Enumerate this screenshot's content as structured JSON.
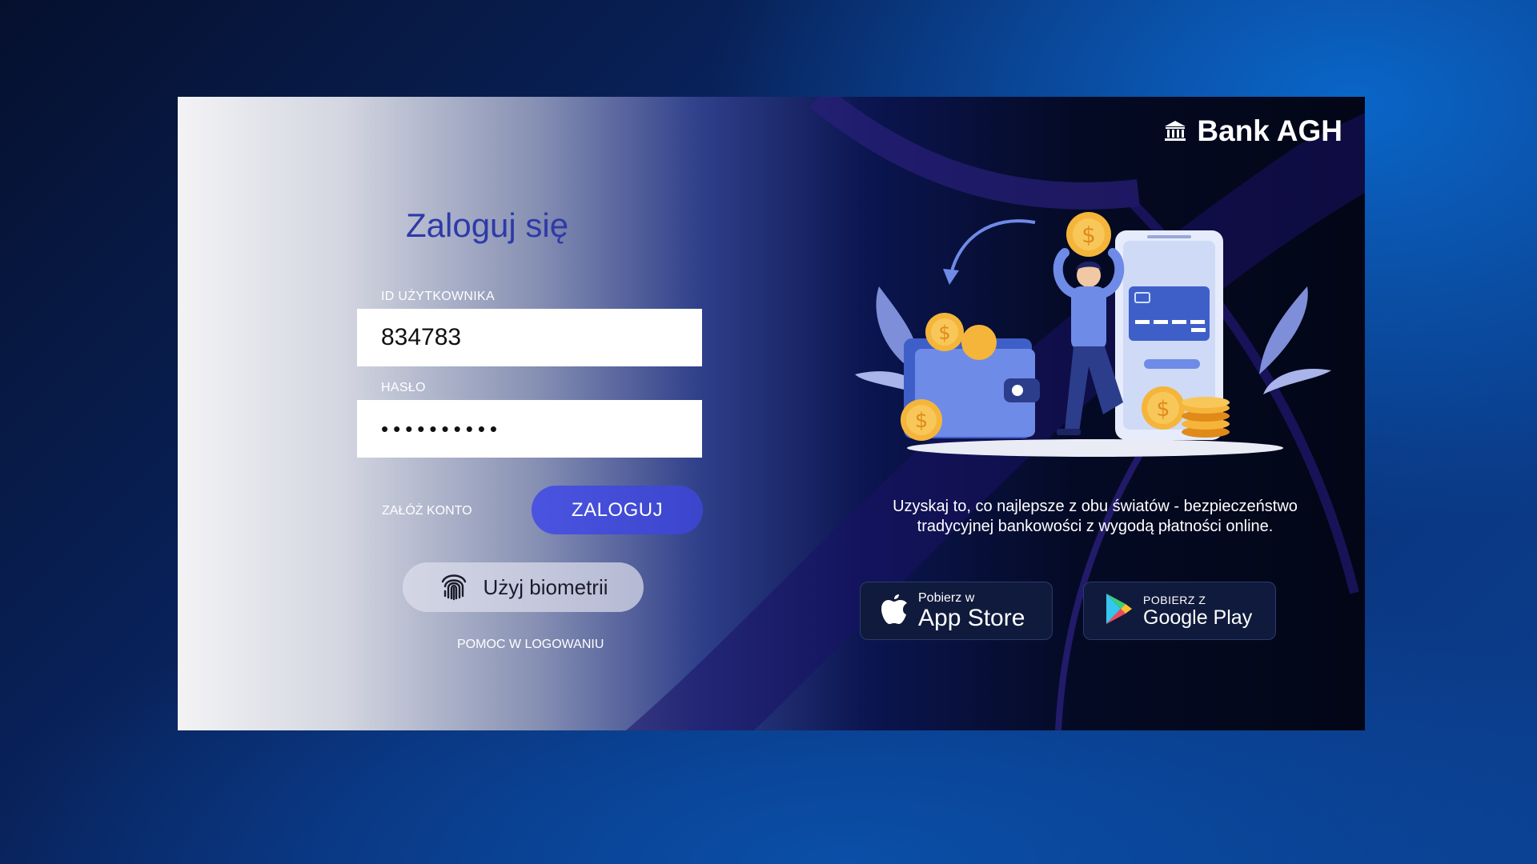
{
  "brand": {
    "name": "Bank AGH",
    "icon": "bank-building-icon"
  },
  "login": {
    "title": "Zaloguj się",
    "user_id": {
      "label": "ID UŻYTKOWNIKA",
      "value": "834783"
    },
    "password": {
      "label": "HASŁO",
      "masked_value": "••••••••••"
    },
    "register_link": "ZAŁÓŻ KONTO",
    "submit_label": "ZALOGUJ",
    "biometrics_label": "Użyj biometrii",
    "biometrics_icon": "fingerprint-icon",
    "help_link": "POMOC W LOGOWANIU"
  },
  "promo": {
    "tagline_lines": [
      "Uzyskaj to, co najlepsze z obu światów - bezpieczeństwo",
      "tradycyjnej bankowości z wygodą płatności online."
    ]
  },
  "stores": {
    "app_store": {
      "small": "Pobierz w",
      "big": "App Store",
      "icon": "apple-icon"
    },
    "google_play": {
      "small": "POBIERZ Z",
      "big": "Google Play",
      "icon": "google-play-icon"
    }
  },
  "colors": {
    "title_blue": "#2e3aa8",
    "button_blue": "#4a54e0",
    "accent_purple": "#2a1f7a",
    "coin_gold": "#f5b53a"
  }
}
